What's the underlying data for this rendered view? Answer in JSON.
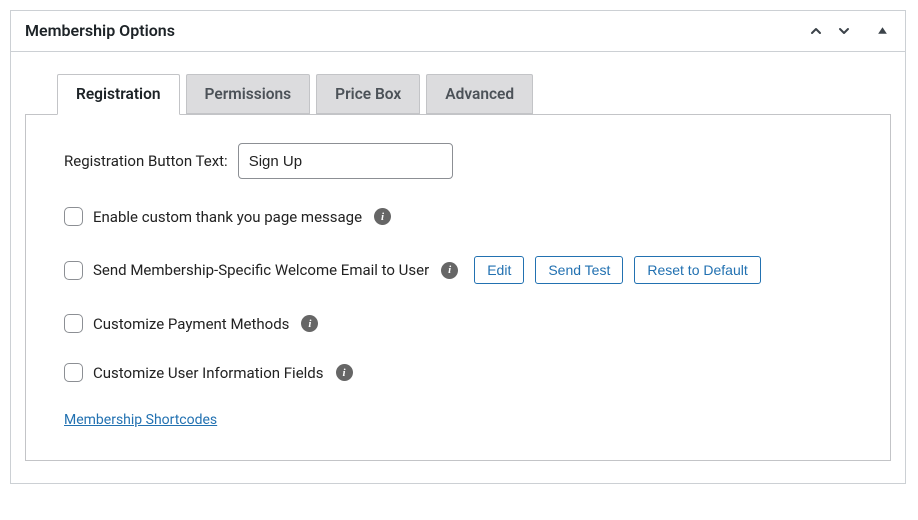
{
  "panel": {
    "title": "Membership Options"
  },
  "tabs": {
    "registration": "Registration",
    "permissions": "Permissions",
    "price_box": "Price Box",
    "advanced": "Advanced"
  },
  "form": {
    "reg_btn_text_label": "Registration Button Text:",
    "reg_btn_text_value": "Sign Up",
    "thank_you_label": "Enable custom thank you page message",
    "welcome_email_label": "Send Membership-Specific Welcome Email to User",
    "customize_payment_label": "Customize Payment Methods",
    "customize_fields_label": "Customize User Information Fields"
  },
  "buttons": {
    "edit": "Edit",
    "send_test": "Send Test",
    "reset": "Reset to Default"
  },
  "link": {
    "shortcodes": "Membership Shortcodes"
  }
}
